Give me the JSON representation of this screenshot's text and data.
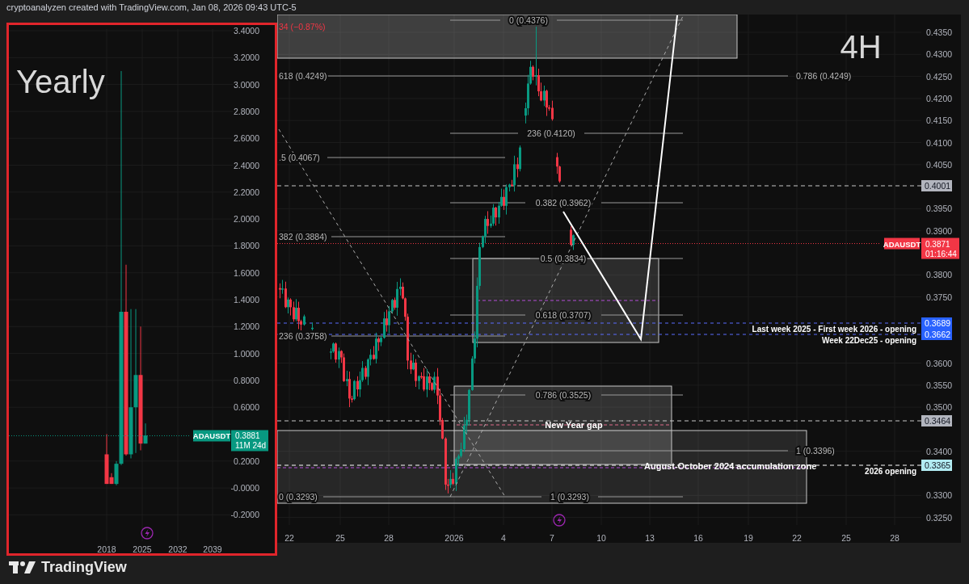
{
  "header": {
    "text": "cryptoanalyzen created with TradingView.com, Jan 08, 2026 09:43 UTC-5"
  },
  "yearly_chart": {
    "title": "Yearly",
    "price_axis": [
      "3.4000",
      "3.2000",
      "3.0000",
      "2.8000",
      "2.6000",
      "2.4000",
      "2.2000",
      "2.0000",
      "1.8000",
      "1.6000",
      "1.4000",
      "1.2000",
      "1.0000",
      "0.8000",
      "0.6000",
      "0.2000",
      "-0.0000",
      "-0.2000"
    ],
    "time_axis": [
      "2018",
      "2025",
      "2032",
      "2039"
    ],
    "symbol_tag": {
      "symbol": "ADAUSDT",
      "price": "0.3881",
      "countdown": "11M 24d"
    }
  },
  "main_chart": {
    "timeframe": "4H",
    "change_text": "34 (−0.87%)",
    "fib_labels": [
      "0 (0.4376)",
      "618 (0.4249)",
      "0.786 (0.4249)",
      "236 (0.4120)",
      ".5 (0.4067)",
      "0.382 (0.3962)",
      "382 (0.3884)",
      "0.5 (0.3834)",
      "0.618 (0.3707)",
      "236 (0.3758)",
      "0.786 (0.3525)",
      "1 (0.3396)",
      "0 (0.3293)",
      "1 (0.3293)"
    ],
    "annotations": [
      "New Year gap",
      "August-October 2024 accumulation zone",
      "Last week 2025 - First week 2026 - opening",
      "Week 22Dec25 - opening",
      "2026 opening"
    ],
    "price_tags": [
      {
        "price": "0.4001",
        "color": "#b2b5be"
      },
      {
        "price": "0.3689",
        "color": "#2962ff"
      },
      {
        "price": "0.3662",
        "color": "#2962ff"
      },
      {
        "price": "0.3464",
        "color": "#b2b5be"
      },
      {
        "price": "0.3365",
        "color": "#b2ebf2"
      }
    ],
    "symbol_tag": {
      "symbol": "ADAUSDT",
      "price": "0.3871",
      "countdown": "01:16:44"
    },
    "price_axis": [
      "0.4350",
      "0.4300",
      "0.4250",
      "0.4200",
      "0.4150",
      "0.4100",
      "0.4050",
      "0.3950",
      "0.3900",
      "0.3800",
      "0.3750",
      "0.3600",
      "0.3550",
      "0.3500",
      "0.3400",
      "0.3300",
      "0.3250"
    ],
    "time_axis": [
      "22",
      "25",
      "28",
      "2026",
      "4",
      "7",
      "10",
      "13",
      "16",
      "19",
      "22",
      "25",
      "28"
    ]
  },
  "footer": {
    "logo_text": "TradingView"
  }
}
